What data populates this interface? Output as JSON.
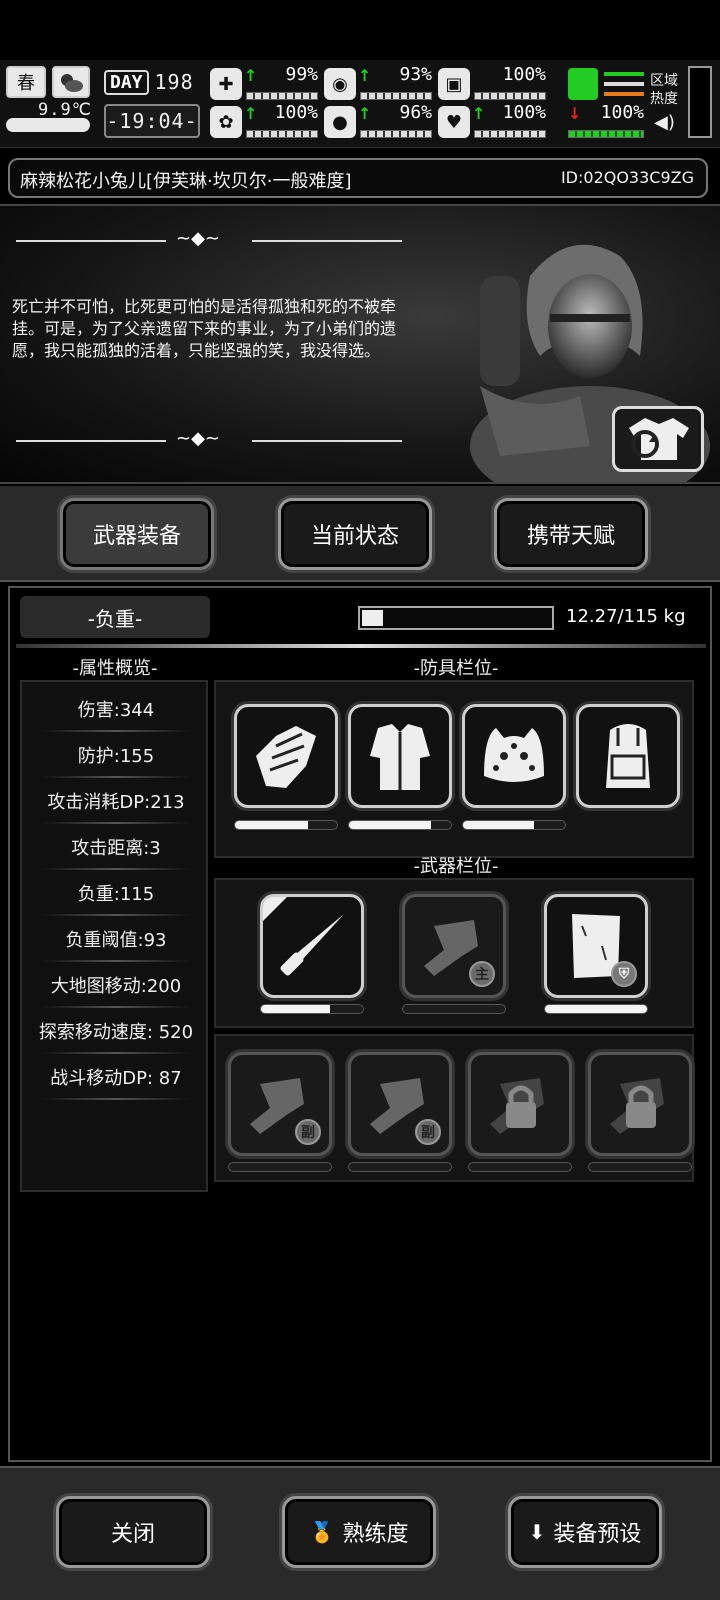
{
  "status": {
    "season": "春",
    "temperature": "9.9℃",
    "day_label": "DAY",
    "day_number": "198",
    "clock": "-19:04-",
    "stats": [
      {
        "name": "health",
        "icon": "medkit-icon",
        "glyph": "✚",
        "trend": "up",
        "value": "99%",
        "level": 0.99
      },
      {
        "name": "hunger",
        "icon": "stomach-icon",
        "glyph": "◉",
        "trend": "up",
        "value": "93%",
        "level": 0.93
      },
      {
        "name": "stamina",
        "icon": "battery-icon",
        "glyph": "▣",
        "trend": "none",
        "value": "100%",
        "level": 1.0
      },
      {
        "name": "mind",
        "icon": "brain-icon",
        "glyph": "✿",
        "trend": "up",
        "value": "100%",
        "level": 1.0
      },
      {
        "name": "thirst",
        "icon": "water-drop-icon",
        "glyph": "💧",
        "trend": "up",
        "value": "96%",
        "level": 0.96
      },
      {
        "name": "mood",
        "icon": "heart-icon",
        "glyph": "♥",
        "trend": "up",
        "value": "100%",
        "level": 1.0
      }
    ],
    "boot": {
      "trend": "down",
      "value": "100%",
      "level": 1.0
    },
    "zone_heat_label": "区域\n热度",
    "colors": {
      "up": "#22cc22",
      "down": "#ee2222",
      "green": "#22cc22",
      "orange": "#e87a1e"
    }
  },
  "character": {
    "name": "麻辣松花小兔儿[伊芙琳·坎贝尔·一般难度]",
    "id": "ID:02QO33C9ZG",
    "quote": "死亡并不可怕，比死更可怕的是活得孤独和死的不被牵挂。可是，为了父亲遗留下来的事业，为了小弟们的遗愿，我只能孤独的活着，只能坚强的笑，我没得选。"
  },
  "tabs": [
    {
      "label": "武器装备",
      "active": true
    },
    {
      "label": "当前状态",
      "active": false
    },
    {
      "label": "携带天赋",
      "active": false
    }
  ],
  "load": {
    "label": "-负重-",
    "text": "12.27/115 kg",
    "fraction": 0.107
  },
  "attributes": {
    "title": "-属性概览-",
    "items": [
      "伤害:344",
      "防护:155",
      "攻击消耗DP:213",
      "攻击距离:3",
      "负重:115",
      "负重阈值:93",
      "大地图移动:200",
      "探索移动速度: 520",
      "战斗移动DP: 87"
    ]
  },
  "armor": {
    "title": "-防具栏位-",
    "slots": [
      {
        "name": "gloves",
        "icon": "gloves-icon",
        "durability": 0.72
      },
      {
        "name": "jacket",
        "icon": "fur-jacket-icon",
        "durability": 0.8
      },
      {
        "name": "hat",
        "icon": "animal-hat-icon",
        "durability": 0.7
      },
      {
        "name": "backpack",
        "icon": "backpack-icon",
        "durability": null
      }
    ]
  },
  "weapons": {
    "title": "-武器栏位-",
    "main_slots": [
      {
        "name": "knife",
        "icon": "knife-icon",
        "durability": 0.68,
        "tag": ""
      },
      {
        "name": "main-fist",
        "icon": "fist-icon",
        "durability": 0.0,
        "tag": "主"
      },
      {
        "name": "shield-paper",
        "icon": "paper-armor-icon",
        "durability": 1.0,
        "tag": ""
      }
    ],
    "sub_slots": [
      {
        "name": "sub-fist-1",
        "icon": "fist-icon",
        "tag": "副",
        "locked": false
      },
      {
        "name": "sub-fist-2",
        "icon": "fist-icon",
        "tag": "副",
        "locked": false
      },
      {
        "name": "locked-1",
        "icon": "lock-icon",
        "tag": "",
        "locked": true
      },
      {
        "name": "locked-2",
        "icon": "lock-icon",
        "tag": "",
        "locked": true
      }
    ]
  },
  "bottom": {
    "close": "关闭",
    "proficiency": "熟练度",
    "preset": "装备预设"
  }
}
